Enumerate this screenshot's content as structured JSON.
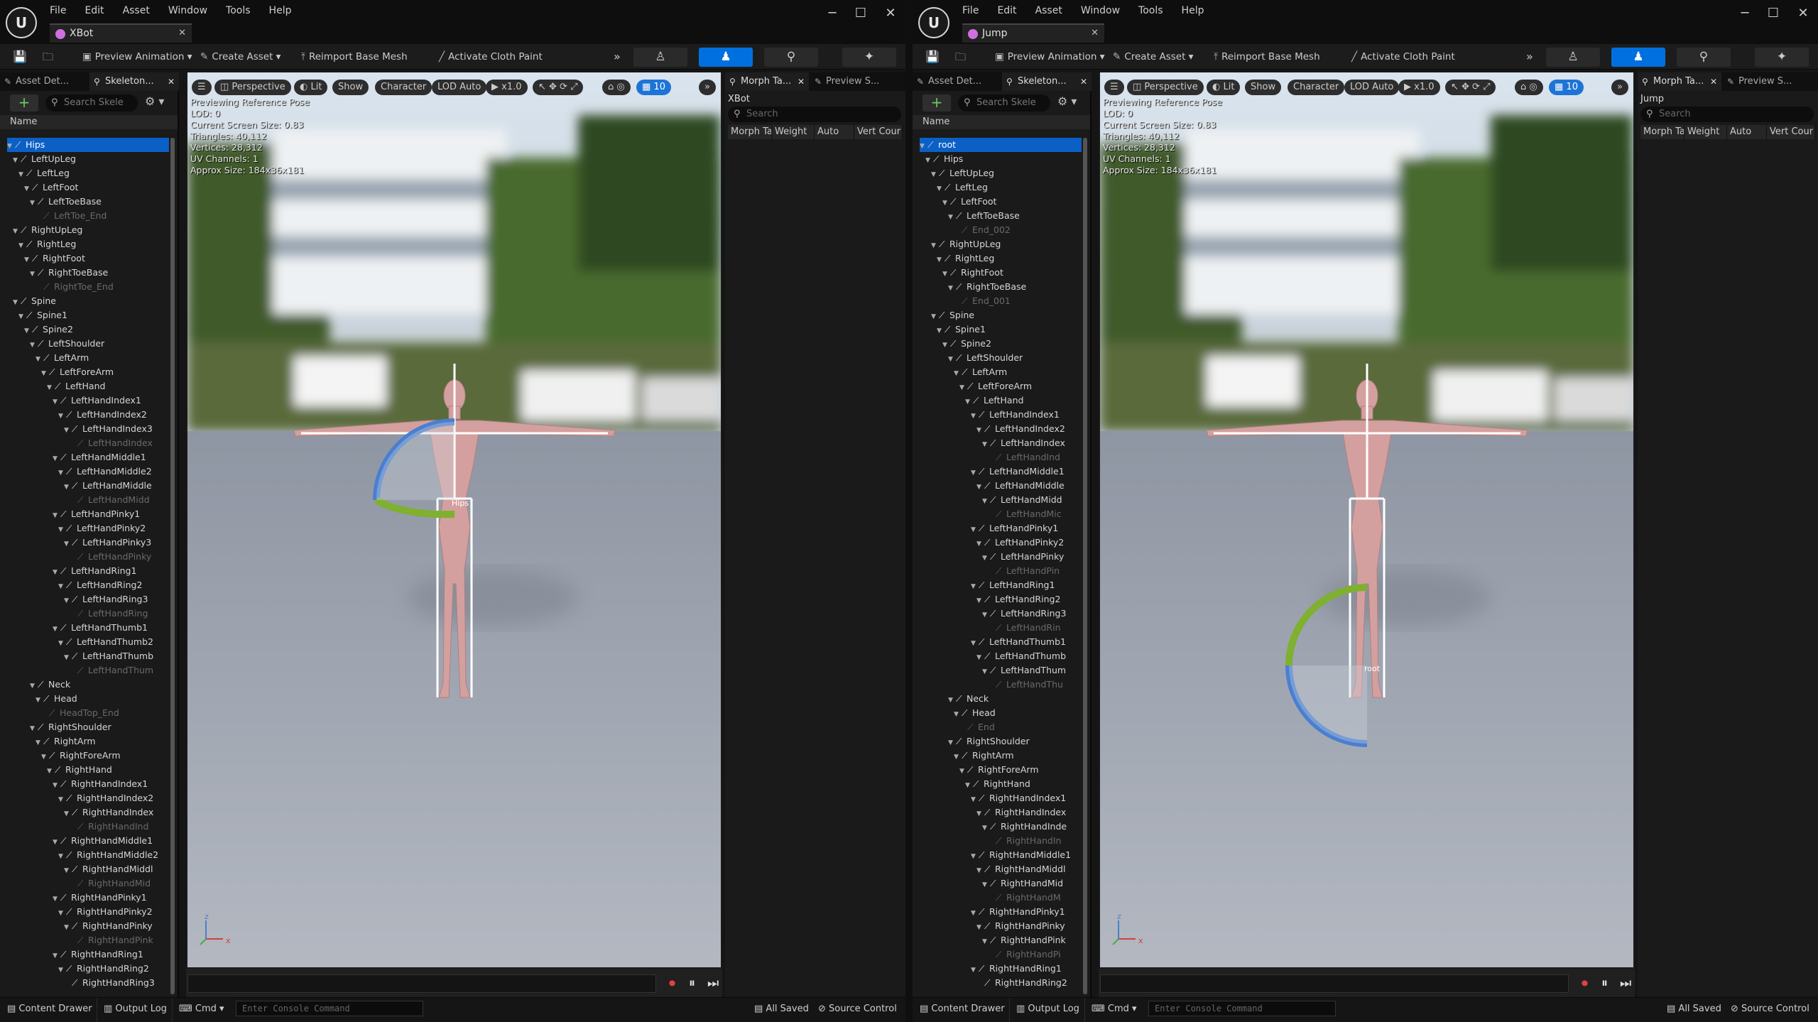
{
  "menu": [
    "File",
    "Edit",
    "Asset",
    "Window",
    "Tools",
    "Help"
  ],
  "toolbar": {
    "preview_animation": "Preview Animation",
    "create_asset": "Create Asset",
    "reimport": "Reimport Base Mesh",
    "cloth": "Activate Cloth Paint"
  },
  "left_tabs": {
    "details": "Asset Det...",
    "skeleton": "Skeleton..."
  },
  "search_placeholder": "Search Skele",
  "name_header": "Name",
  "viewport": {
    "perspective": "Perspective",
    "lit": "Lit",
    "show": "Show",
    "character": "Character",
    "lod": "LOD Auto",
    "speed": "x1.0",
    "grid": "10"
  },
  "stats": [
    "Previewing Reference Pose",
    "LOD: 0",
    "Current Screen Size: 0.83",
    "Triangles: 40,112",
    "Vertices: 28,312",
    "UV Channels: 1",
    "Approx Size: 184x36x181"
  ],
  "right_tabs": {
    "morph": "Morph Ta...",
    "preview": "Preview S..."
  },
  "morph_search": "Search",
  "morph_cols": [
    "Morph Ta",
    "Weight",
    "Auto",
    "Vert Cour"
  ],
  "status": {
    "content_drawer": "Content Drawer",
    "output_log": "Output Log",
    "cmd": "Cmd",
    "console_placeholder": "Enter Console Command",
    "all_saved": "All Saved",
    "source_control": "Source Control"
  },
  "windows": [
    {
      "tab": "XBot",
      "gizmo_label": "Hips",
      "morph_title": "XBot",
      "tree": [
        {
          "d": 0,
          "t": "Hips",
          "sel": true
        },
        {
          "d": 1,
          "t": "LeftUpLeg"
        },
        {
          "d": 2,
          "t": "LeftLeg"
        },
        {
          "d": 3,
          "t": "LeftFoot"
        },
        {
          "d": 4,
          "t": "LeftToeBase"
        },
        {
          "d": 5,
          "t": "LeftToe_End",
          "dim": true
        },
        {
          "d": 1,
          "t": "RightUpLeg"
        },
        {
          "d": 2,
          "t": "RightLeg"
        },
        {
          "d": 3,
          "t": "RightFoot"
        },
        {
          "d": 4,
          "t": "RightToeBase"
        },
        {
          "d": 5,
          "t": "RightToe_End",
          "dim": true
        },
        {
          "d": 1,
          "t": "Spine"
        },
        {
          "d": 2,
          "t": "Spine1"
        },
        {
          "d": 3,
          "t": "Spine2"
        },
        {
          "d": 4,
          "t": "LeftShoulder"
        },
        {
          "d": 5,
          "t": "LeftArm"
        },
        {
          "d": 6,
          "t": "LeftForeArm"
        },
        {
          "d": 7,
          "t": "LeftHand"
        },
        {
          "d": 8,
          "t": "LeftHandIndex1"
        },
        {
          "d": 9,
          "t": "LeftHandIndex2"
        },
        {
          "d": 10,
          "t": "LeftHandIndex3"
        },
        {
          "d": 11,
          "t": "LeftHandIndex",
          "dim": true
        },
        {
          "d": 8,
          "t": "LeftHandMiddle1"
        },
        {
          "d": 9,
          "t": "LeftHandMiddle2"
        },
        {
          "d": 10,
          "t": "LeftHandMiddle"
        },
        {
          "d": 11,
          "t": "LeftHandMidd",
          "dim": true
        },
        {
          "d": 8,
          "t": "LeftHandPinky1"
        },
        {
          "d": 9,
          "t": "LeftHandPinky2"
        },
        {
          "d": 10,
          "t": "LeftHandPinky3"
        },
        {
          "d": 11,
          "t": "LeftHandPinky",
          "dim": true
        },
        {
          "d": 8,
          "t": "LeftHandRing1"
        },
        {
          "d": 9,
          "t": "LeftHandRing2"
        },
        {
          "d": 10,
          "t": "LeftHandRing3"
        },
        {
          "d": 11,
          "t": "LeftHandRing",
          "dim": true
        },
        {
          "d": 8,
          "t": "LeftHandThumb1"
        },
        {
          "d": 9,
          "t": "LeftHandThumb2"
        },
        {
          "d": 10,
          "t": "LeftHandThumb"
        },
        {
          "d": 11,
          "t": "LeftHandThum",
          "dim": true
        },
        {
          "d": 4,
          "t": "Neck"
        },
        {
          "d": 5,
          "t": "Head"
        },
        {
          "d": 6,
          "t": "HeadTop_End",
          "dim": true
        },
        {
          "d": 4,
          "t": "RightShoulder"
        },
        {
          "d": 5,
          "t": "RightArm"
        },
        {
          "d": 6,
          "t": "RightForeArm"
        },
        {
          "d": 7,
          "t": "RightHand"
        },
        {
          "d": 8,
          "t": "RightHandIndex1"
        },
        {
          "d": 9,
          "t": "RightHandIndex2"
        },
        {
          "d": 10,
          "t": "RightHandIndex"
        },
        {
          "d": 11,
          "t": "RightHandInd",
          "dim": true
        },
        {
          "d": 8,
          "t": "RightHandMiddle1"
        },
        {
          "d": 9,
          "t": "RightHandMiddle2"
        },
        {
          "d": 10,
          "t": "RightHandMiddl"
        },
        {
          "d": 11,
          "t": "RightHandMid",
          "dim": true
        },
        {
          "d": 8,
          "t": "RightHandPinky1"
        },
        {
          "d": 9,
          "t": "RightHandPinky2"
        },
        {
          "d": 10,
          "t": "RightHandPinky"
        },
        {
          "d": 11,
          "t": "RightHandPink",
          "dim": true
        },
        {
          "d": 8,
          "t": "RightHandRing1"
        },
        {
          "d": 9,
          "t": "RightHandRing2"
        },
        {
          "d": 10,
          "t": "RightHandRing3"
        }
      ]
    },
    {
      "tab": "Jump",
      "gizmo_label": "root",
      "morph_title": "Jump",
      "tree": [
        {
          "d": 0,
          "t": "root",
          "sel": true
        },
        {
          "d": 1,
          "t": "Hips"
        },
        {
          "d": 2,
          "t": "LeftUpLeg"
        },
        {
          "d": 3,
          "t": "LeftLeg"
        },
        {
          "d": 4,
          "t": "LeftFoot"
        },
        {
          "d": 5,
          "t": "LeftToeBase"
        },
        {
          "d": 6,
          "t": "End_002",
          "dim": true
        },
        {
          "d": 2,
          "t": "RightUpLeg"
        },
        {
          "d": 3,
          "t": "RightLeg"
        },
        {
          "d": 4,
          "t": "RightFoot"
        },
        {
          "d": 5,
          "t": "RightToeBase"
        },
        {
          "d": 6,
          "t": "End_001",
          "dim": true
        },
        {
          "d": 2,
          "t": "Spine"
        },
        {
          "d": 3,
          "t": "Spine1"
        },
        {
          "d": 4,
          "t": "Spine2"
        },
        {
          "d": 5,
          "t": "LeftShoulder"
        },
        {
          "d": 6,
          "t": "LeftArm"
        },
        {
          "d": 7,
          "t": "LeftForeArm"
        },
        {
          "d": 8,
          "t": "LeftHand"
        },
        {
          "d": 9,
          "t": "LeftHandIndex1"
        },
        {
          "d": 10,
          "t": "LeftHandIndex2"
        },
        {
          "d": 11,
          "t": "LeftHandIndex"
        },
        {
          "d": 12,
          "t": "LeftHandInd",
          "dim": true
        },
        {
          "d": 9,
          "t": "LeftHandMiddle1"
        },
        {
          "d": 10,
          "t": "LeftHandMiddle"
        },
        {
          "d": 11,
          "t": "LeftHandMidd"
        },
        {
          "d": 12,
          "t": "LeftHandMic",
          "dim": true
        },
        {
          "d": 9,
          "t": "LeftHandPinky1"
        },
        {
          "d": 10,
          "t": "LeftHandPinky2"
        },
        {
          "d": 11,
          "t": "LeftHandPinky"
        },
        {
          "d": 12,
          "t": "LeftHandPin",
          "dim": true
        },
        {
          "d": 9,
          "t": "LeftHandRing1"
        },
        {
          "d": 10,
          "t": "LeftHandRing2"
        },
        {
          "d": 11,
          "t": "LeftHandRing3"
        },
        {
          "d": 12,
          "t": "LeftHandRin",
          "dim": true
        },
        {
          "d": 9,
          "t": "LeftHandThumb1"
        },
        {
          "d": 10,
          "t": "LeftHandThumb"
        },
        {
          "d": 11,
          "t": "LeftHandThum"
        },
        {
          "d": 12,
          "t": "LeftHandThu",
          "dim": true
        },
        {
          "d": 5,
          "t": "Neck"
        },
        {
          "d": 6,
          "t": "Head"
        },
        {
          "d": 7,
          "t": "End",
          "dim": true
        },
        {
          "d": 5,
          "t": "RightShoulder"
        },
        {
          "d": 6,
          "t": "RightArm"
        },
        {
          "d": 7,
          "t": "RightForeArm"
        },
        {
          "d": 8,
          "t": "RightHand"
        },
        {
          "d": 9,
          "t": "RightHandIndex1"
        },
        {
          "d": 10,
          "t": "RightHandIndex"
        },
        {
          "d": 11,
          "t": "RightHandInde"
        },
        {
          "d": 12,
          "t": "RightHandIn",
          "dim": true
        },
        {
          "d": 9,
          "t": "RightHandMiddle1"
        },
        {
          "d": 10,
          "t": "RightHandMiddl"
        },
        {
          "d": 11,
          "t": "RightHandMid"
        },
        {
          "d": 12,
          "t": "RightHandM",
          "dim": true
        },
        {
          "d": 9,
          "t": "RightHandPinky1"
        },
        {
          "d": 10,
          "t": "RightHandPinky"
        },
        {
          "d": 11,
          "t": "RightHandPink"
        },
        {
          "d": 12,
          "t": "RightHandPi",
          "dim": true
        },
        {
          "d": 9,
          "t": "RightHandRing1"
        },
        {
          "d": 10,
          "t": "RightHandRing2"
        }
      ]
    }
  ]
}
